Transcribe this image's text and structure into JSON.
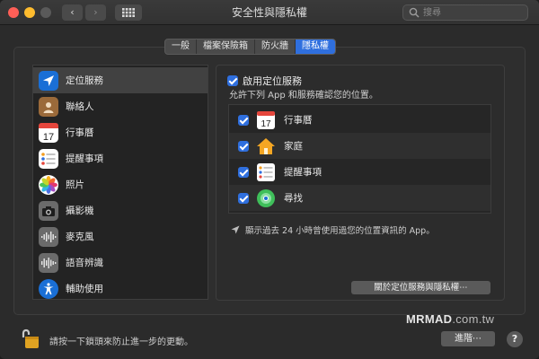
{
  "window": {
    "title": "安全性與隱私權",
    "back_label": "‹",
    "forward_label": "›"
  },
  "search": {
    "placeholder": "搜尋"
  },
  "tabs": [
    {
      "label": "一般"
    },
    {
      "label": "檔案保險箱"
    },
    {
      "label": "防火牆"
    },
    {
      "label": "隱私權",
      "selected": true
    }
  ],
  "sidebar": {
    "items": [
      {
        "label": "定位服務",
        "icon": "location-icon",
        "selected": true
      },
      {
        "label": "聯絡人",
        "icon": "contacts-icon"
      },
      {
        "label": "行事曆",
        "icon": "calendar-icon"
      },
      {
        "label": "提醒事項",
        "icon": "reminders-icon"
      },
      {
        "label": "照片",
        "icon": "photos-icon"
      },
      {
        "label": "攝影機",
        "icon": "camera-icon"
      },
      {
        "label": "麥克風",
        "icon": "microphone-icon"
      },
      {
        "label": "語音辨識",
        "icon": "speech-recognition-icon"
      },
      {
        "label": "輔助使用",
        "icon": "accessibility-icon"
      }
    ]
  },
  "location": {
    "enable_label": "啟用定位服務",
    "enabled": true,
    "allow_text": "允許下列 App 和服務確認您的位置。",
    "apps": [
      {
        "label": "行事曆",
        "icon": "calendar-icon",
        "checked": true,
        "calendar_day": "17"
      },
      {
        "label": "家庭",
        "icon": "home-icon",
        "checked": true
      },
      {
        "label": "提醒事項",
        "icon": "reminders-icon",
        "checked": true
      },
      {
        "label": "尋找",
        "icon": "find-my-icon",
        "checked": true
      }
    ],
    "recent_text": "顯示過去 24 小時曾使用過您的位置資訊的 App。",
    "about_button": "關於定位服務與隱私權⋯"
  },
  "footer": {
    "lock_text": "請按一下鎖頭來防止進一步的更動。",
    "advanced_button": "進階⋯",
    "help_button": "?",
    "watermark_main": "MRMAD",
    "watermark_domain": ".com.tw"
  },
  "colors": {
    "accent": "#2f6fde",
    "window_bg": "#2b2b2b"
  }
}
